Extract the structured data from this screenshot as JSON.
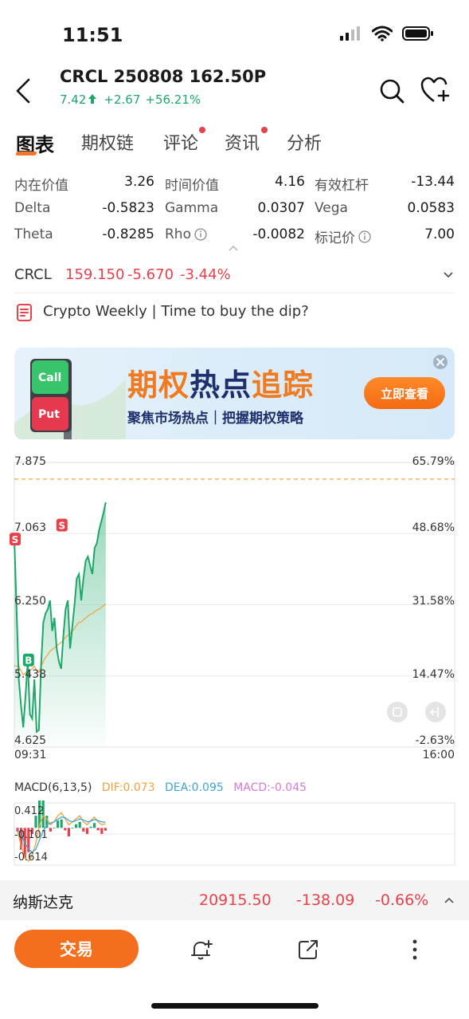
{
  "status": {
    "time": "11:51"
  },
  "header": {
    "title": "CRCL 250808 162.50P",
    "price": "7.42",
    "change": "+2.67",
    "change_pct": "+56.21%"
  },
  "tabs": [
    {
      "label": "图表",
      "active": true
    },
    {
      "label": "期权链"
    },
    {
      "label": "评论",
      "dot": true
    },
    {
      "label": "资讯",
      "dot": true
    },
    {
      "label": "分析"
    }
  ],
  "metrics": [
    [
      {
        "label": "内在价值",
        "value": "3.26"
      },
      {
        "label": "时间价值",
        "value": "4.16"
      },
      {
        "label": "有效杠杆",
        "value": "-13.44"
      }
    ],
    [
      {
        "label": "Delta",
        "value": "-0.5823"
      },
      {
        "label": "Gamma",
        "value": "0.0307"
      },
      {
        "label": "Vega",
        "value": "0.0583"
      }
    ],
    [
      {
        "label": "Theta",
        "value": "-0.8285"
      },
      {
        "label": "Rho",
        "value": "-0.0082",
        "info": true
      },
      {
        "label": "标记价",
        "value": "7.00",
        "info": true
      }
    ]
  ],
  "underlying": {
    "symbol": "CRCL",
    "price": "159.150",
    "change": "-5.670",
    "change_pct": "-3.44%"
  },
  "news": {
    "text": "Crypto Weekly | Time to buy the dip?"
  },
  "banner": {
    "title_part1": "期权",
    "title_part2": "热点",
    "title_part3": "追踪",
    "subtitle": "聚焦市场热点｜把握期权策略",
    "button": "立即查看",
    "call_label": "Call",
    "put_label": "Put"
  },
  "chart_data": {
    "type": "line",
    "y_left_ticks": [
      "7.875",
      "7.063",
      "6.250",
      "5.438",
      "4.625"
    ],
    "y_right_ticks": [
      "65.79%",
      "48.68%",
      "31.58%",
      "14.47%",
      "-2.63%"
    ],
    "x_ticks": [
      "09:31",
      "16:00"
    ],
    "ylim": [
      4.625,
      7.875
    ],
    "prev_close_line": 7.685,
    "markers": [
      {
        "label": "S",
        "x": 0,
        "y": 7.0
      },
      {
        "label": "B",
        "x": 18,
        "y": 5.62
      },
      {
        "label": "S",
        "x": 63,
        "y": 7.16
      }
    ],
    "series": [
      {
        "values": [
          7.0,
          6.2,
          5.4,
          5.1,
          4.85,
          5.2,
          5.6,
          5.0,
          4.95,
          5.4,
          4.8,
          4.82,
          5.55,
          6.05,
          6.15,
          6.2,
          6.3,
          5.95,
          6.1,
          5.75,
          5.6,
          5.52,
          5.9,
          6.2,
          6.3,
          5.75,
          6.0,
          6.25,
          6.55,
          6.6,
          6.3,
          6.55,
          6.75,
          6.8,
          6.7,
          6.6,
          6.9,
          6.95,
          7.1,
          7.2,
          7.3,
          7.42
        ]
      },
      {
        "values": [
          5.55,
          5.55,
          5.55,
          5.5,
          5.45,
          5.47,
          5.5,
          5.5,
          5.52,
          5.55,
          5.5,
          5.48,
          5.55,
          5.6,
          5.65,
          5.68,
          5.72,
          5.74,
          5.76,
          5.78,
          5.8,
          5.82,
          5.85,
          5.88,
          5.9,
          5.92,
          5.95,
          5.98,
          6.02,
          6.05,
          6.05,
          6.08,
          6.1,
          6.12,
          6.14,
          6.15,
          6.17,
          6.19,
          6.2,
          6.22,
          6.24,
          6.26
        ]
      }
    ]
  },
  "macd": {
    "title": "MACD(6,13,5)",
    "dif": "DIF:0.073",
    "dea": "DEA:0.095",
    "macd": "MACD:-0.045",
    "ticks": [
      "0.412",
      "-0.101",
      "-0.614"
    ],
    "ylim": [
      -0.614,
      0.412
    ],
    "dif_values": [
      -0.05,
      -0.3,
      -0.5,
      -0.55,
      -0.45,
      -0.25,
      0.05,
      0.2,
      0.15,
      0.05,
      0.1,
      0.2,
      0.25,
      0.15,
      0.05,
      0.1,
      0.15,
      0.2,
      0.1,
      0.05,
      0.12,
      0.18,
      0.1,
      0.05,
      0.07
    ],
    "dea_values": [
      -0.02,
      -0.12,
      -0.25,
      -0.35,
      -0.4,
      -0.35,
      -0.2,
      -0.05,
      0.05,
      0.08,
      0.1,
      0.14,
      0.18,
      0.17,
      0.12,
      0.1,
      0.12,
      0.15,
      0.13,
      0.1,
      0.11,
      0.14,
      0.12,
      0.1,
      0.095
    ],
    "hist_values": [
      -0.06,
      -0.36,
      -0.5,
      -0.4,
      -0.1,
      0.2,
      0.5,
      0.5,
      0.2,
      -0.06,
      0.0,
      0.12,
      0.14,
      -0.04,
      -0.14,
      0.0,
      0.06,
      0.1,
      -0.06,
      -0.1,
      0.02,
      0.08,
      -0.04,
      -0.1,
      -0.045
    ]
  },
  "index": {
    "name": "纳斯达克",
    "value": "20915.50",
    "change": "-138.09",
    "change_pct": "-0.66%"
  },
  "bottom": {
    "trade": "交易"
  },
  "colors": {
    "accent": "#f46f1d",
    "up": "#1da86a",
    "down": "#e8414a",
    "dif": "#f0a23a",
    "dea": "#3aa5d6",
    "macd": "#d57ad8"
  }
}
